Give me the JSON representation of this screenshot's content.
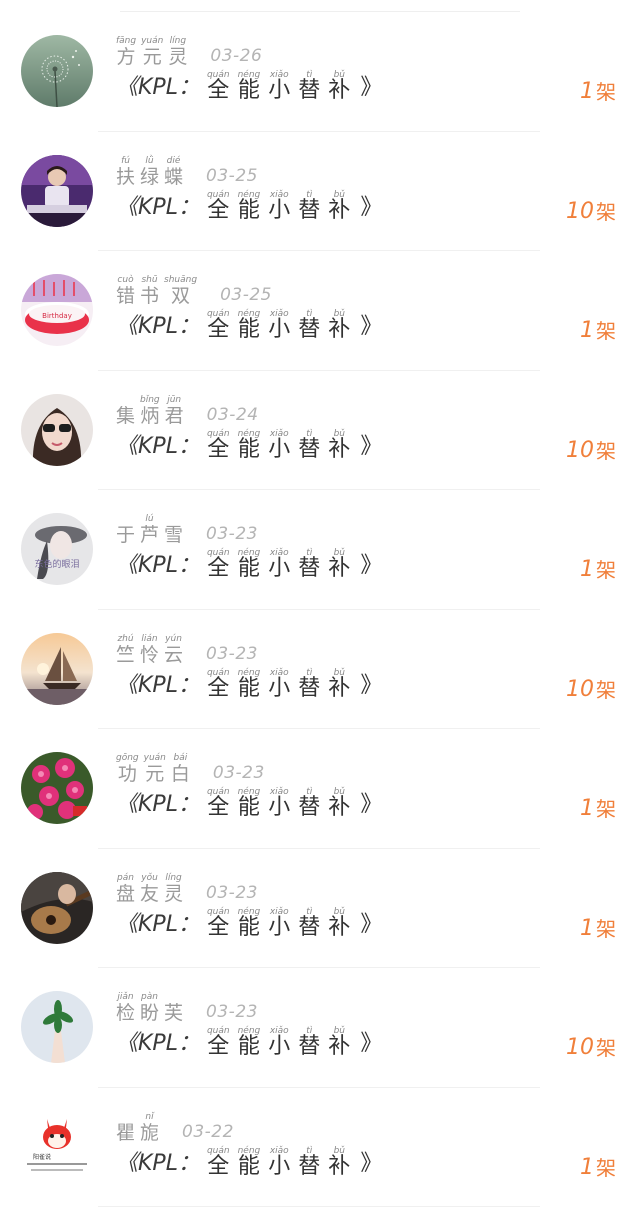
{
  "accent_color": "#f07f3a",
  "rows": [
    {
      "name": [
        {
          "py": "fāng",
          "hz": "方"
        },
        {
          "py": "yuán",
          "hz": "元"
        },
        {
          "py": "líng",
          "hz": "灵"
        }
      ],
      "date": "03-26",
      "title_prefix": "《KPL： ",
      "title": [
        {
          "py": "quán",
          "hz": "全"
        },
        {
          "py": "néng",
          "hz": "能"
        },
        {
          "py": "xiǎo",
          "hz": "小"
        },
        {
          "py": "tì",
          "hz": "替"
        },
        {
          "py": "bǔ",
          "hz": "补"
        }
      ],
      "title_suffix": "》",
      "qty_num": "1",
      "qty_unit": "架",
      "avatar": "dandelion"
    },
    {
      "name": [
        {
          "py": "fú",
          "hz": "扶"
        },
        {
          "py": "lǜ",
          "hz": "绿"
        },
        {
          "py": "dié",
          "hz": "蝶"
        }
      ],
      "date": "03-25",
      "title_prefix": "《KPL： ",
      "title": [
        {
          "py": "quán",
          "hz": "全"
        },
        {
          "py": "néng",
          "hz": "能"
        },
        {
          "py": "xiǎo",
          "hz": "小"
        },
        {
          "py": "tì",
          "hz": "替"
        },
        {
          "py": "bǔ",
          "hz": "补"
        }
      ],
      "title_suffix": "》",
      "qty_num": "10",
      "qty_unit": "架",
      "avatar": "pianist"
    },
    {
      "name": [
        {
          "py": "cuò",
          "hz": "错"
        },
        {
          "py": "shū",
          "hz": "书"
        },
        {
          "py": "shuāng",
          "hz": "双"
        }
      ],
      "date": "03-25",
      "title_prefix": "《KPL： ",
      "title": [
        {
          "py": "quán",
          "hz": "全"
        },
        {
          "py": "néng",
          "hz": "能"
        },
        {
          "py": "xiǎo",
          "hz": "小"
        },
        {
          "py": "tì",
          "hz": "替"
        },
        {
          "py": "bǔ",
          "hz": "补"
        }
      ],
      "title_suffix": "》",
      "qty_num": "1",
      "qty_unit": "架",
      "avatar": "cake"
    },
    {
      "name": [
        {
          "py": "",
          "hz": "集"
        },
        {
          "py": "bǐng",
          "hz": "炳"
        },
        {
          "py": "jūn",
          "hz": "君"
        }
      ],
      "date": "03-24",
      "title_prefix": "《KPL： ",
      "title": [
        {
          "py": "quán",
          "hz": "全"
        },
        {
          "py": "néng",
          "hz": "能"
        },
        {
          "py": "xiǎo",
          "hz": "小"
        },
        {
          "py": "tì",
          "hz": "替"
        },
        {
          "py": "bǔ",
          "hz": "补"
        }
      ],
      "title_suffix": "》",
      "qty_num": "10",
      "qty_unit": "架",
      "avatar": "girl-sunglasses"
    },
    {
      "name": [
        {
          "py": "",
          "hz": "于"
        },
        {
          "py": "lú",
          "hz": "芦"
        },
        {
          "py": "",
          "hz": "雪"
        }
      ],
      "date": "03-23",
      "title_prefix": "《KPL： ",
      "title": [
        {
          "py": "quán",
          "hz": "全"
        },
        {
          "py": "néng",
          "hz": "能"
        },
        {
          "py": "xiǎo",
          "hz": "小"
        },
        {
          "py": "tì",
          "hz": "替"
        },
        {
          "py": "bǔ",
          "hz": "补"
        }
      ],
      "title_suffix": "》",
      "qty_num": "1",
      "qty_unit": "架",
      "avatar": "girl-hat",
      "avatar_caption": "东色的眼泪"
    },
    {
      "name": [
        {
          "py": "zhú",
          "hz": "竺"
        },
        {
          "py": "lián",
          "hz": "怜"
        },
        {
          "py": "yún",
          "hz": "云"
        }
      ],
      "date": "03-23",
      "title_prefix": "《KPL： ",
      "title": [
        {
          "py": "quán",
          "hz": "全"
        },
        {
          "py": "néng",
          "hz": "能"
        },
        {
          "py": "xiǎo",
          "hz": "小"
        },
        {
          "py": "tì",
          "hz": "替"
        },
        {
          "py": "bǔ",
          "hz": "补"
        }
      ],
      "title_suffix": "》",
      "qty_num": "10",
      "qty_unit": "架",
      "avatar": "sailboat"
    },
    {
      "name": [
        {
          "py": "gōng",
          "hz": "功"
        },
        {
          "py": "yuán",
          "hz": "元"
        },
        {
          "py": "bái",
          "hz": "白"
        }
      ],
      "date": "03-23",
      "title_prefix": "《KPL： ",
      "title": [
        {
          "py": "quán",
          "hz": "全"
        },
        {
          "py": "néng",
          "hz": "能"
        },
        {
          "py": "xiǎo",
          "hz": "小"
        },
        {
          "py": "tì",
          "hz": "替"
        },
        {
          "py": "bǔ",
          "hz": "补"
        }
      ],
      "title_suffix": "》",
      "qty_num": "1",
      "qty_unit": "架",
      "avatar": "flowers"
    },
    {
      "name": [
        {
          "py": "pán",
          "hz": "盘"
        },
        {
          "py": "yǒu",
          "hz": "友"
        },
        {
          "py": "líng",
          "hz": "灵"
        }
      ],
      "date": "03-23",
      "title_prefix": "《KPL： ",
      "title": [
        {
          "py": "quán",
          "hz": "全"
        },
        {
          "py": "néng",
          "hz": "能"
        },
        {
          "py": "xiǎo",
          "hz": "小"
        },
        {
          "py": "tì",
          "hz": "替"
        },
        {
          "py": "bǔ",
          "hz": "补"
        }
      ],
      "title_suffix": "》",
      "qty_num": "1",
      "qty_unit": "架",
      "avatar": "guitar"
    },
    {
      "name": [
        {
          "py": "jiǎn",
          "hz": "检"
        },
        {
          "py": "pàn",
          "hz": "盼"
        },
        {
          "py": "",
          "hz": "芙"
        }
      ],
      "date": "03-23",
      "title_prefix": "《KPL： ",
      "title": [
        {
          "py": "quán",
          "hz": "全"
        },
        {
          "py": "néng",
          "hz": "能"
        },
        {
          "py": "xiǎo",
          "hz": "小"
        },
        {
          "py": "tì",
          "hz": "替"
        },
        {
          "py": "bǔ",
          "hz": "补"
        }
      ],
      "title_suffix": "》",
      "qty_num": "10",
      "qty_unit": "架",
      "avatar": "leaf-hand"
    },
    {
      "name": [
        {
          "py": "",
          "hz": "瞿"
        },
        {
          "py": "nǐ",
          "hz": "旎"
        }
      ],
      "date": "03-22",
      "title_prefix": "《KPL： ",
      "title": [
        {
          "py": "quán",
          "hz": "全"
        },
        {
          "py": "néng",
          "hz": "能"
        },
        {
          "py": "xiǎo",
          "hz": "小"
        },
        {
          "py": "tì",
          "hz": "替"
        },
        {
          "py": "bǔ",
          "hz": "补"
        }
      ],
      "title_suffix": "》",
      "qty_num": "1",
      "qty_unit": "架",
      "avatar": "cartoon-fox",
      "avatar_caption": "阳雀说"
    }
  ]
}
